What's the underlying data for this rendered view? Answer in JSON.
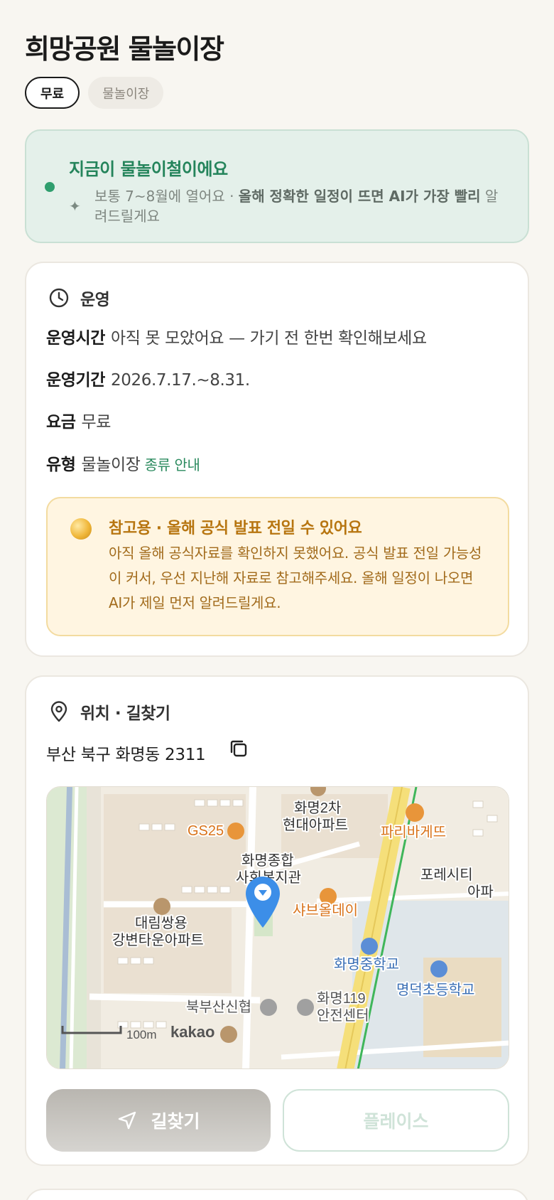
{
  "title": "희망공원 물놀이장",
  "chips": {
    "price": "무료",
    "type": "물놀이장"
  },
  "season": {
    "headline": "지금이 물놀이철이에요",
    "note_plain": "보통 7~8월에 열어요 · ",
    "note_bold": "올해 정확한 일정이 뜨면 AI가 가장 빨리",
    "note_tail": "알려드릴게요",
    "dot_color": "#2f9e6e"
  },
  "operation": {
    "section_title": "운영",
    "section_icon": "clock-icon",
    "hours_label": "운영시간",
    "hours_value": "아직 못 모았어요 — 가기 전 한번 확인해보세요",
    "period_label": "운영기간",
    "period_value": "2026.7.17.~8.31.",
    "fee_label": "요금",
    "fee_value": "무료",
    "type_label": "유형",
    "type_value": "물놀이장",
    "type_link": "종류 안내",
    "notice_title": "참고용 · 올해 공식 발표 전일 수 있어요",
    "notice_body": "아직 올해 공식자료를 확인하지 못했어요. 공식 발표 전일 가능성이 커서, 우선 지난해 자료로 참고해주세요. 올해 일정이 나오면 AI가 제일 먼저 알려드릴게요.",
    "notice_icon": "coin-icon"
  },
  "location": {
    "section_title": "위치 · 길찾기",
    "section_icon": "map-pin-icon",
    "address": "부산 북구 화명동 2311",
    "copy_icon": "copy-icon",
    "map": {
      "labels": {
        "apt2": "화명2차",
        "apt2b": "현대아파트",
        "gs25": "GS25",
        "paris": "파리바게뜨",
        "welfare1": "화명종합",
        "welfare2": "사회복지관",
        "forest1": "포레시티",
        "forest2": "아파",
        "daelim1": "대림쌍용",
        "daelim2": "강변타운아파트",
        "shabu": "샤브올데이",
        "middle": "화명중학교",
        "elem": "명덕초등학교",
        "bank": "북부산신협",
        "safety1": "화명119",
        "safety2": "안전센터",
        "scale": "100m",
        "brand": "kakao"
      }
    },
    "directions_button": "길찾기",
    "place_button": "플레이스"
  }
}
